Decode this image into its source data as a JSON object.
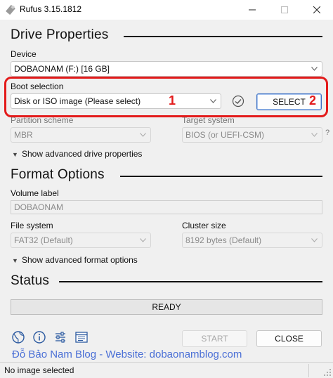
{
  "window": {
    "title": "Rufus 3.15.1812",
    "minimize_icon": "minimize-icon",
    "maximize_icon": "maximize-icon",
    "close_icon": "close-icon"
  },
  "drive_properties": {
    "heading": "Drive Properties",
    "device_label": "Device",
    "device_value": "DOBAONAM (F:) [16 GB]",
    "boot_selection_label": "Boot selection",
    "boot_selection_value": "Disk or ISO image (Please select)",
    "select_button": "SELECT",
    "partition_scheme_label": "Partition scheme",
    "partition_scheme_value": "MBR",
    "target_system_label": "Target system",
    "target_system_value": "BIOS (or UEFI-CSM)",
    "target_system_help": "?",
    "advanced_toggle": "Show advanced drive properties"
  },
  "format_options": {
    "heading": "Format Options",
    "volume_label_label": "Volume label",
    "volume_label_value": "DOBAONAM",
    "file_system_label": "File system",
    "file_system_value": "FAT32 (Default)",
    "cluster_size_label": "Cluster size",
    "cluster_size_value": "8192 bytes (Default)",
    "advanced_toggle": "Show advanced format options"
  },
  "status": {
    "heading": "Status",
    "progress_text": "READY",
    "progress_fraction": 0
  },
  "annotations": {
    "marker_1": "1",
    "marker_2": "2",
    "highlight_color": "#e31b1b"
  },
  "toolbar": {
    "icons": [
      "globe-icon",
      "info-icon",
      "settings-sliders-icon",
      "log-icon"
    ],
    "start_button": "START",
    "close_button": "CLOSE"
  },
  "watermark": "Đỗ Bảo Nam Blog - Website: dobaonamblog.com",
  "statusbar": {
    "text": "No image selected"
  },
  "colors": {
    "accent_blue": "#3a6fc2",
    "watermark_blue": "#4a6fd6"
  }
}
